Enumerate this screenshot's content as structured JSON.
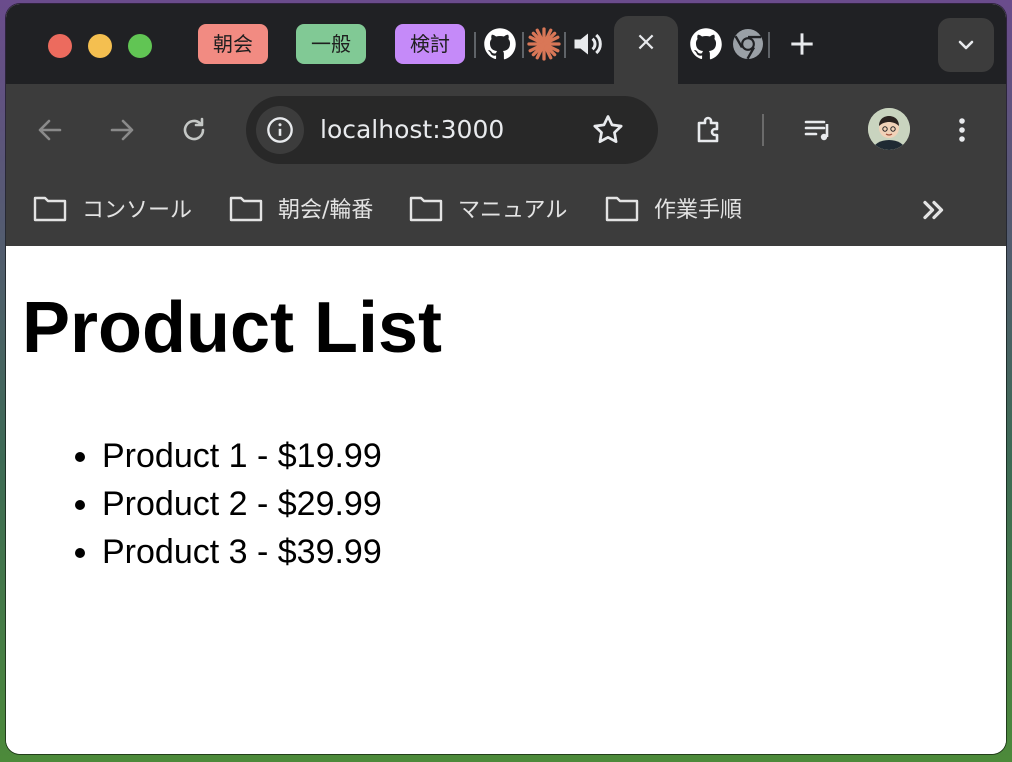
{
  "tabstrip": {
    "tab_groups": [
      {
        "label": "朝会",
        "color": "#f28b82"
      },
      {
        "label": "一般",
        "color": "#81c995"
      },
      {
        "label": "検討",
        "color": "#c58af9"
      }
    ],
    "pinned_tabs": [
      "github-icon",
      "claude-spark-icon",
      "speaker-icon",
      "github-icon",
      "chrome-icon"
    ],
    "active_tab_close": "×"
  },
  "toolbar": {
    "url": "localhost:3000"
  },
  "bookmarks": {
    "items": [
      "コンソール",
      "朝会/輪番",
      "マニュアル",
      "作業手順"
    ]
  },
  "page": {
    "title": "Product List",
    "products": [
      "Product 1 - $19.99",
      "Product 2 - $29.99",
      "Product 3 - $39.99"
    ]
  }
}
